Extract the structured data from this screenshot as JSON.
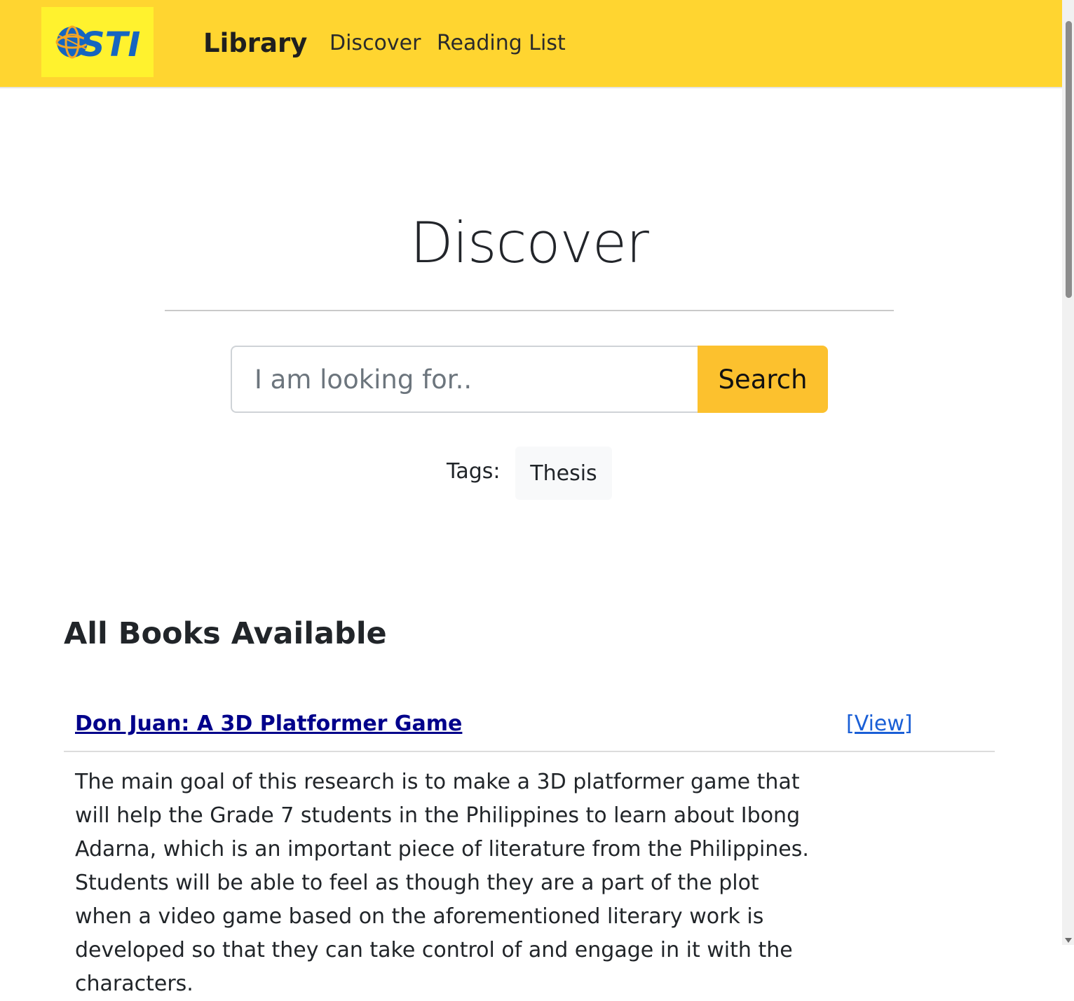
{
  "navbar": {
    "logo_text": "STI",
    "brand": "Library",
    "links": [
      {
        "label": "Discover"
      },
      {
        "label": "Reading List"
      }
    ]
  },
  "hero": {
    "title": "Discover"
  },
  "search": {
    "placeholder": "I am looking for..",
    "value": "",
    "button_label": "Search"
  },
  "tags": {
    "label": "Tags:",
    "items": [
      "Thesis"
    ]
  },
  "books_section": {
    "title": "All Books Available",
    "books": [
      {
        "title": "Don Juan: A 3D Platformer Game",
        "view_label": "[View]",
        "description": "The main goal of this research is to make a 3D platformer game that will help the Grade 7 students in the Philippines to learn about Ibong Adarna, which is an important piece of literature from the Philippines. Students will be able to feel as though they are a part of the plot when a video game based on the aforementioned literary work is developed so that they can take control of and engage in it with the characters."
      }
    ]
  },
  "colors": {
    "navbar_bg": "#ffd530",
    "logo_bg": "#fff22e",
    "logo_blue": "#1565c0",
    "search_button": "#fcc12e",
    "book_title_link": "#00008b",
    "view_link": "#1a5fd6"
  }
}
